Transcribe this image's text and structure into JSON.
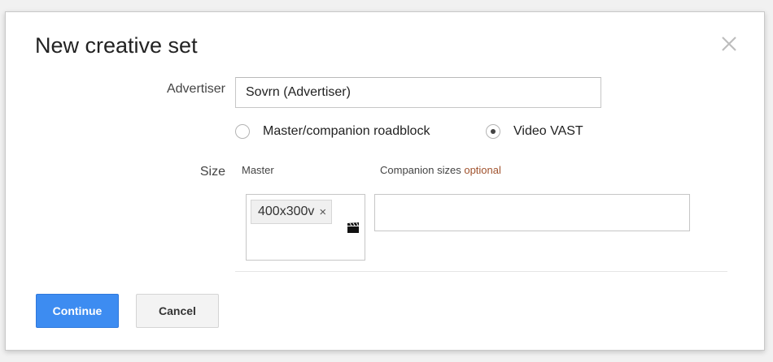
{
  "dialog": {
    "title": "New creative set",
    "close_icon": "close-icon"
  },
  "advertiser": {
    "label": "Advertiser",
    "value": "Sovrn (Advertiser)"
  },
  "type_options": [
    {
      "label": "Master/companion roadblock",
      "selected": false
    },
    {
      "label": "Video VAST",
      "selected": true
    }
  ],
  "size": {
    "label": "Size",
    "master_label": "Master",
    "companion_label": "Companion sizes",
    "companion_optional": "optional",
    "master_chip": "400x300v",
    "chip_remove": "×",
    "video_icon": "clapperboard-icon",
    "companion_value": ""
  },
  "buttons": {
    "continue": "Continue",
    "cancel": "Cancel"
  },
  "colors": {
    "accent": "#3d8cf1",
    "optional": "#a0522d"
  }
}
